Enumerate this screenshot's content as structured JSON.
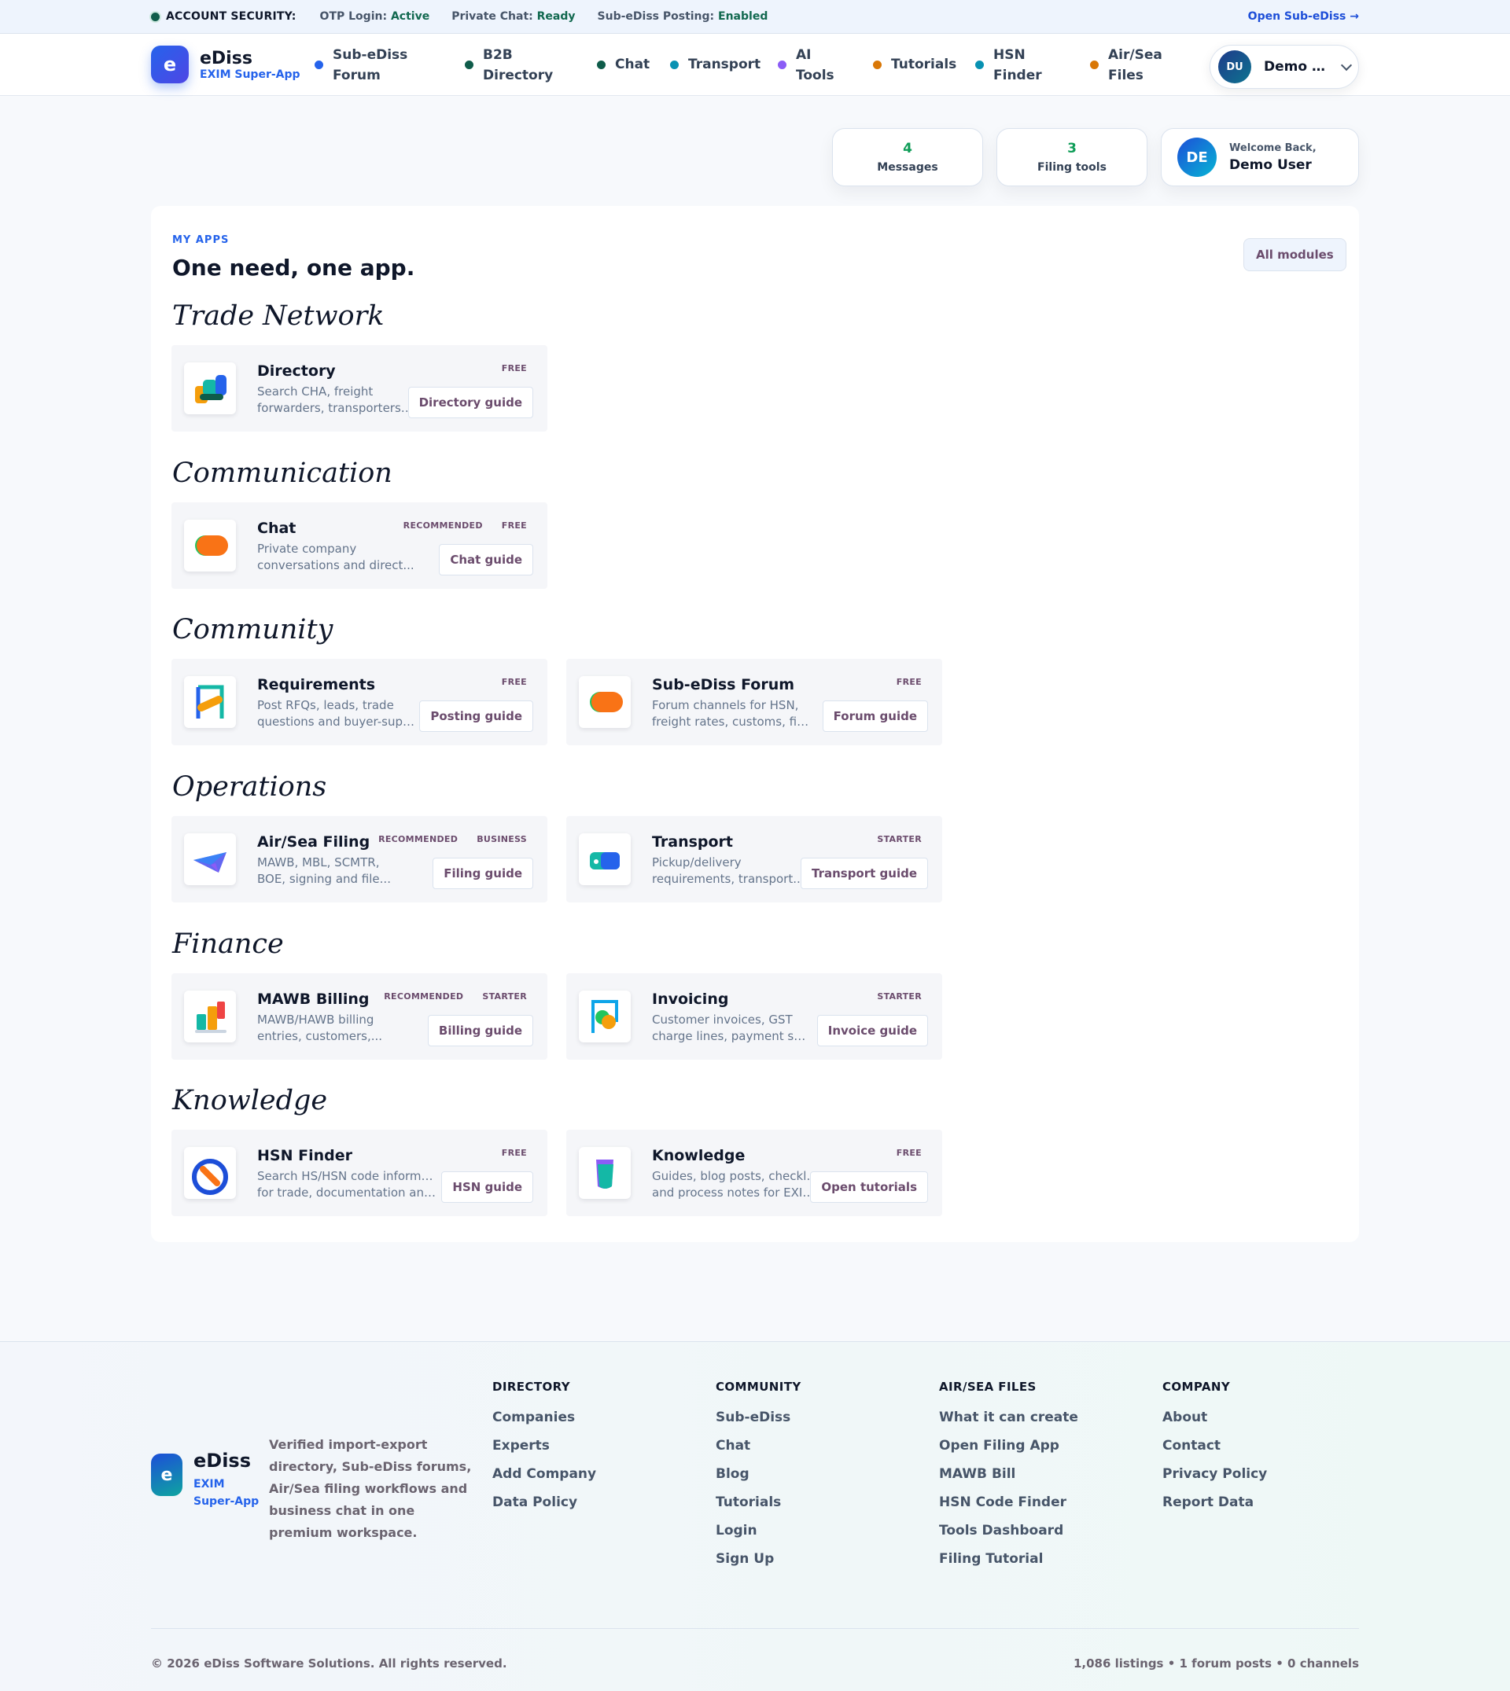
{
  "security": {
    "title": "ACCOUNT SECURITY:",
    "items": [
      {
        "label": "OTP Login:",
        "value": "Active"
      },
      {
        "label": "Private Chat:",
        "value": "Ready"
      },
      {
        "label": "Sub-eDiss Posting:",
        "value": "Enabled"
      }
    ],
    "open_link": "Open Sub-eDiss →"
  },
  "brand": {
    "logo_letter": "e",
    "name": "eDiss",
    "subtitle": "EXIM Super-App"
  },
  "nav": {
    "items": [
      {
        "line1": "Sub-eDiss",
        "line2": "Forum",
        "color": "#2563eb"
      },
      {
        "line1": "B2B",
        "line2": "Directory",
        "color": "#0f5c4a"
      },
      {
        "line1": "Chat",
        "line2": "",
        "color": "#0f5c4a"
      },
      {
        "line1": "Transport",
        "line2": "",
        "color": "#0891b2"
      },
      {
        "line1": "AI",
        "line2": "Tools",
        "color": "#8b5cf6"
      },
      {
        "line1": "Tutorials",
        "line2": "",
        "color": "#d97706"
      },
      {
        "line1": "HSN",
        "line2": "Finder",
        "color": "#0891b2"
      },
      {
        "line1": "Air/Sea",
        "line2": "Files",
        "color": "#d97706"
      }
    ],
    "user_initials": "DU",
    "user_name": "Demo User"
  },
  "stats": {
    "messages": {
      "count": "4",
      "label": "Messages"
    },
    "filing": {
      "count": "3",
      "label": "Filing tools"
    },
    "welcome": {
      "initials": "DE",
      "greeting": "Welcome Back,",
      "name": "Demo User"
    }
  },
  "apps": {
    "eyebrow": "MY APPS",
    "title": "One need, one app.",
    "all_modules": "All modules",
    "sections": [
      {
        "title": "Trade Network",
        "cards": [
          {
            "title": "Directory",
            "desc1": "Search CHA, freight",
            "desc2": "forwarders, transporters,...",
            "badges": [
              "FREE"
            ],
            "guide": "Directory guide",
            "icon": "directory-icon"
          }
        ]
      },
      {
        "title": "Communication",
        "cards": [
          {
            "title": "Chat",
            "desc1": "Private company",
            "desc2": "conversations and direct...",
            "badges": [
              "RECOMMENDED",
              "FREE"
            ],
            "guide": "Chat guide",
            "icon": "chat-icon"
          }
        ]
      },
      {
        "title": "Community",
        "cards": [
          {
            "title": "Requirements",
            "desc1": "Post RFQs, leads, trade",
            "desc2": "questions and buyer-supplie...",
            "badges": [
              "FREE"
            ],
            "guide": "Posting guide",
            "icon": "requirements-icon"
          },
          {
            "title": "Sub-eDiss Forum",
            "desc1": "Forum channels for HSN,",
            "desc2": "freight rates, customs, filing...",
            "badges": [
              "FREE"
            ],
            "guide": "Forum guide",
            "icon": "forum-icon"
          }
        ]
      },
      {
        "title": "Operations",
        "cards": [
          {
            "title": "Air/Sea Filing",
            "desc1": "MAWB, MBL, SCMTR,",
            "desc2": "BOE, signing and file...",
            "badges": [
              "RECOMMENDED",
              "BUSINESS"
            ],
            "guide": "Filing guide",
            "icon": "paper-plane-icon"
          },
          {
            "title": "Transport",
            "desc1": "Pickup/delivery",
            "desc2": "requirements, transport...",
            "badges": [
              "STARTER"
            ],
            "guide": "Transport guide",
            "icon": "transport-icon"
          }
        ]
      },
      {
        "title": "Finance",
        "cards": [
          {
            "title": "MAWB Billing",
            "desc1": "MAWB/HAWB billing",
            "desc2": "entries, customers,...",
            "badges": [
              "RECOMMENDED",
              "STARTER"
            ],
            "guide": "Billing guide",
            "icon": "billing-icon"
          },
          {
            "title": "Invoicing",
            "desc1": "Customer invoices, GST",
            "desc2": "charge lines, payment status,...",
            "badges": [
              "STARTER"
            ],
            "guide": "Invoice guide",
            "icon": "invoice-icon"
          }
        ]
      },
      {
        "title": "Knowledge",
        "cards": [
          {
            "title": "HSN Finder",
            "desc1": "Search HS/HSN code information",
            "desc2": "for trade, documentation and...",
            "badges": [
              "FREE"
            ],
            "guide": "HSN guide",
            "icon": "hsn-finder-icon"
          },
          {
            "title": "Knowledge",
            "desc1": "Guides, blog posts, checklists",
            "desc2": "and process notes for EXIM...",
            "badges": [
              "FREE"
            ],
            "guide": "Open tutorials",
            "icon": "knowledge-icon"
          }
        ]
      }
    ]
  },
  "footer": {
    "logo_letter": "e",
    "name": "eDiss",
    "subtitle": "EXIM Super-App",
    "tagline": "Verified import-export directory, Sub-eDiss forums, Air/Sea filing workflows and business chat in one premium workspace.",
    "columns": [
      {
        "title": "DIRECTORY",
        "links": [
          "Companies",
          "Experts",
          "Add Company",
          "Data Policy"
        ]
      },
      {
        "title": "COMMUNITY",
        "links": [
          "Sub-eDiss",
          "Chat",
          "Blog",
          "Tutorials",
          "Login",
          "Sign Up"
        ]
      },
      {
        "title": "AIR/SEA FILES",
        "links": [
          "What it can create",
          "Open Filing App",
          "MAWB Bill",
          "HSN Code Finder",
          "Tools Dashboard",
          "Filing Tutorial"
        ]
      },
      {
        "title": "COMPANY",
        "links": [
          "About",
          "Contact",
          "Privacy Policy",
          "Report Data"
        ]
      }
    ],
    "copyright": "© 2026 eDiss Software Solutions. All rights reserved.",
    "counts": "1,086 listings • 1 forum posts • 0 channels"
  }
}
